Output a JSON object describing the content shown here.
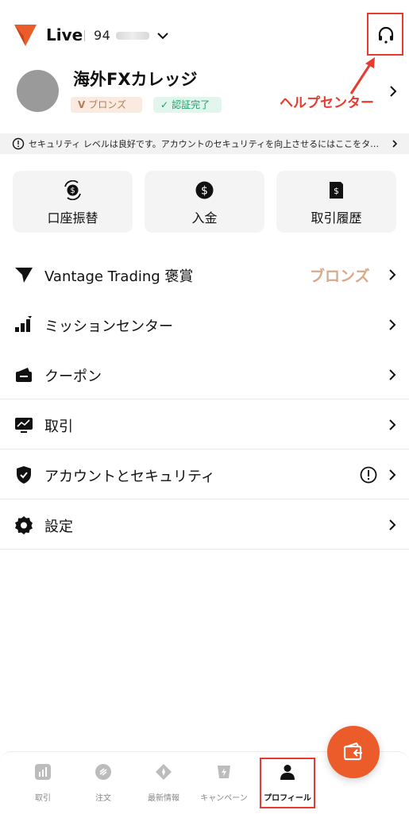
{
  "header": {
    "mode": "Live",
    "account_number": "94",
    "help_center_label": "ヘルプセンター",
    "accent": "#e63b2e"
  },
  "profile": {
    "name": "海外FXカレッジ",
    "tier_badge": "ブロンズ",
    "verified_badge": "認証完了"
  },
  "security_banner": {
    "text": "セキュリティ レベルは良好です。アカウントのセキュリティを向上させるにはここをタ…"
  },
  "quick_actions": [
    {
      "label": "口座振替",
      "icon": "transfer-icon"
    },
    {
      "label": "入金",
      "icon": "dollar-icon"
    },
    {
      "label": "取引履歴",
      "icon": "history-icon"
    }
  ],
  "menu": [
    {
      "label": "Vantage Trading 褒賞",
      "value": "ブロンズ",
      "icon": "vantage-logo-icon"
    },
    {
      "label": "ミッションセンター",
      "icon": "mission-icon"
    },
    {
      "label": "クーポン",
      "icon": "coupon-icon"
    },
    {
      "label": "取引",
      "icon": "trading-icon"
    },
    {
      "label": "アカウントとセキュリティ",
      "icon": "shield-icon"
    },
    {
      "label": "設定",
      "icon": "gear-icon"
    }
  ],
  "bottom_nav": [
    {
      "label": "取引",
      "icon": "chart-icon"
    },
    {
      "label": "注文",
      "icon": "orders-icon"
    },
    {
      "label": "最新情報",
      "icon": "news-icon"
    },
    {
      "label": "キャンペーン",
      "icon": "campaign-icon"
    },
    {
      "label": "プロフィール",
      "icon": "person-icon",
      "active": true
    }
  ],
  "colors": {
    "brand": "#ec5c2b",
    "bronze": "#d9a98a",
    "verified": "#22a06b"
  }
}
